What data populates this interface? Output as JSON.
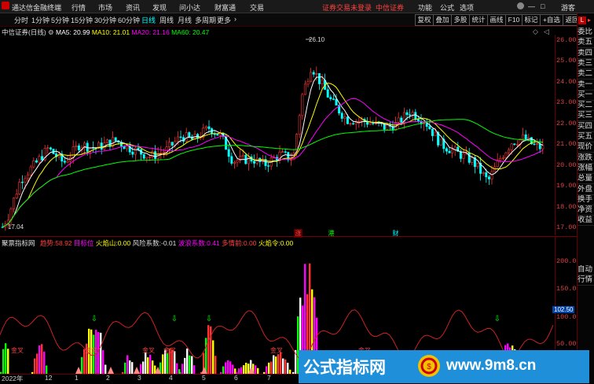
{
  "titlebar": {
    "app_title": "通达信金融终端",
    "menu": [
      "行情",
      "市场",
      "资讯",
      "发现",
      "问小达",
      "财富通",
      "交易"
    ],
    "notice": "证券交易未登录",
    "broker": "中信证券",
    "right_menu": [
      "功能",
      "公式",
      "选项"
    ],
    "guest": "游客"
  },
  "toolbar": {
    "periods": [
      "分时",
      "1分钟",
      "5分钟",
      "15分钟",
      "30分钟",
      "60分钟",
      "日线",
      "周线",
      "月线",
      "多周期",
      "更多"
    ],
    "active_period": "日线",
    "right_buttons": [
      "复权",
      "叠加",
      "多股",
      "统计",
      "画线",
      "F10",
      "标记",
      "+自选",
      "返回"
    ]
  },
  "chart_header": {
    "stock": "中信证券(日线)",
    "ma5": "MA5: 20.99",
    "ma10": "MA10: 21.01",
    "ma20": "MA20: 21.16",
    "ma60": "MA60: 20.47"
  },
  "price_axis": [
    "26.00",
    "25.00",
    "24.00",
    "23.00",
    "22.00",
    "21.00",
    "20.00",
    "19.00",
    "18.00",
    "17.00"
  ],
  "annotations": {
    "high": "26.10",
    "low": "17.04",
    "markers": [
      "涨",
      "港",
      "财"
    ]
  },
  "indicator_header": {
    "name": "聚票指标网",
    "items": [
      {
        "label": "趋势:",
        "value": "58.92"
      },
      {
        "label": "目标位",
        "value": ""
      },
      {
        "label": "火焰山:",
        "value": "0.00"
      },
      {
        "label": "风险系数:",
        "value": "-0.01"
      },
      {
        "label": "波浪系数:",
        "value": "0.41"
      },
      {
        "label": "多情前:",
        "value": "0.00"
      },
      {
        "label": "火焰令:",
        "value": "0.00"
      }
    ]
  },
  "indicator_axis": [
    "200.0",
    "150.0",
    "100.0",
    "50.00"
  ],
  "indicator_current": "102.50",
  "indicator_markers": [
    "金叉",
    "金叉",
    "金叉",
    "金叉",
    "金叉",
    "金叉"
  ],
  "date_axis": [
    "2022年",
    "12",
    "1",
    "2",
    "3",
    "4",
    "5",
    "6",
    "7"
  ],
  "side_panel": [
    "委比",
    "卖五",
    "卖四",
    "卖三",
    "卖二",
    "卖一",
    "买一",
    "买二",
    "买三",
    "买四",
    "买五",
    "现价",
    "涨跌",
    "涨幅",
    "总量",
    "外盘",
    "换手",
    "净资",
    "收益"
  ],
  "side_panel_tab": "L",
  "side_bottom": [
    "自动",
    "行情"
  ],
  "watermark": {
    "text1": "公式指标网",
    "text2": "www.9m8.cn"
  },
  "colors": {
    "up": "#ff3333",
    "down": "#00ffff",
    "ma5": "#ffffff",
    "ma10": "#ffff00",
    "ma20": "#ff00ff",
    "ma60": "#00ff00",
    "watermark_bg": "#1e8fd8"
  }
}
